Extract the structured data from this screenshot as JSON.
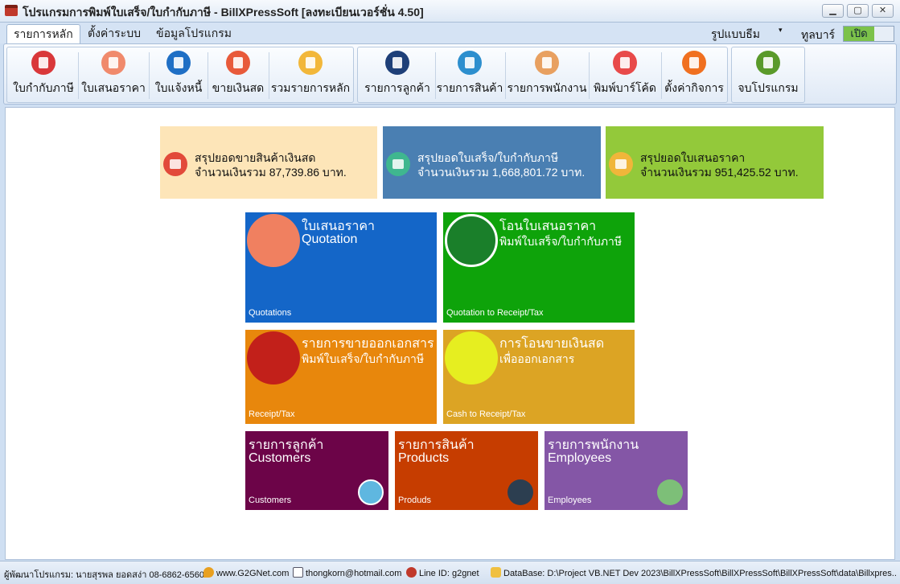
{
  "window": {
    "title": "โปรแกรมการพิมพ์ใบเสร็จ/ใบกำกับภาษี - BillXPressSoft [ลงทะเบียนเวอร์ชั่น 4.50]",
    "icon": "cash-register-icon",
    "minimize": "▁",
    "maximize": "▢",
    "close": "✕"
  },
  "tabs": [
    "รายการหลัก",
    "ตั้งค่าระบบ",
    "ข้อมูลโปรแกรม"
  ],
  "theme": {
    "label": "รูปแบบธีม",
    "caret": "▾"
  },
  "toolbar": {
    "label": "ทูลบาร์",
    "toggle": "เปิด"
  },
  "ribbon": {
    "group1": [
      {
        "label": "ใบกำกับภาษี",
        "icon": "invoice-icon",
        "color": "#d9383a"
      },
      {
        "label": "ใบเสนอราคา",
        "icon": "quotation-icon",
        "color": "#f08a6c"
      },
      {
        "label": "ใบแจ้งหนี้",
        "icon": "bill-icon",
        "color": "#1f6fc5"
      },
      {
        "label": "ขายเงินสด",
        "icon": "cash-sale-icon",
        "color": "#e85a3a"
      },
      {
        "label": "รวมรายการหลัก",
        "icon": "transfer-icon",
        "color": "#f2b73a"
      }
    ],
    "group2": [
      {
        "label": "รายการลูกค้า",
        "icon": "customer-card-icon",
        "color": "#1e3f78"
      },
      {
        "label": "รายการสินค้า",
        "icon": "products-icon",
        "color": "#2d8fce"
      },
      {
        "label": "รายการพนักงาน",
        "icon": "employees-icon",
        "color": "#e8a060"
      },
      {
        "label": "พิมพ์บาร์โค้ด",
        "icon": "barcode-icon",
        "color": "#e84a4a"
      },
      {
        "label": "ตั้งค่ากิจการ",
        "icon": "company-settings-icon",
        "color": "#f07020"
      }
    ],
    "group3": [
      {
        "label": "จบโปรแกรม",
        "icon": "power-icon",
        "color": "#5a9a2a"
      }
    ]
  },
  "summaries": [
    {
      "line1": "สรุปยอดขายสินค้าเงินสด",
      "line2": "จำนวนเงินรวม 87,739.86 บาท.",
      "bg": "#fde5b8",
      "fg": "#111111",
      "icon": "cash-icon",
      "icon_color": "#e24a3a"
    },
    {
      "line1": "สรุปยอดใบเสร็จ/ใบกำกับภาษี",
      "line2": "จำนวนเงินรวม 1,668,801.72 บาท.",
      "bg": "#4a7fb2",
      "fg": "#ffffff",
      "icon": "receipt-icon",
      "icon_color": "#3fb78f"
    },
    {
      "line1": "สรุปยอดใบเสนอราคา",
      "line2": "จำนวนเงินรวม 951,425.52 บาท.",
      "bg": "#93c93a",
      "fg": "#111111",
      "icon": "quote-summary-icon",
      "icon_color": "#f0b63a"
    }
  ],
  "tiles": [
    {
      "title1": "ใบเสนอราคา",
      "title2": "Quotation",
      "footer": "Quotations",
      "bg": "#1466c8",
      "icon": "quotation-document-icon",
      "icon_color": "#f08060"
    },
    {
      "title1": "โอนใบเสนอราคา",
      "title2": "พิมพ์ใบเสร็จ/ใบกำกับภาษี",
      "footer": "Quotation to Receipt/Tax",
      "bg": "#0ea30a",
      "icon": "clipboard-check-icon",
      "icon_color": "#1a7f2a"
    },
    {
      "title1": "รายการขายออกเอกสาร",
      "title2": "พิมพ์ใบเสร็จ/ใบกำกับภาษี",
      "footer": "Receipt/Tax",
      "bg": "#e8870c",
      "icon": "tax-document-icon",
      "icon_color": "#c2201a"
    },
    {
      "title1": "การโอนขายเงินสด",
      "title2": "เพื่อออกเอกสาร",
      "footer": "Cash to Receipt/Tax",
      "bg": "#dca424",
      "icon": "cash-register-icon",
      "icon_color": "#e6ee20"
    },
    {
      "title1": "รายการลูกค้า",
      "title2": "Customers",
      "footer": "Customers",
      "bg": "#6c0448",
      "icon": "customers-group-icon",
      "icon_color": "#5fb7e0"
    },
    {
      "title1": "รายการสินค้า",
      "title2": "Products",
      "footer": "Produds",
      "bg": "#c63d00",
      "icon": "hand-truck-icon",
      "icon_color": "#2c3e50"
    },
    {
      "title1": "รายการพนักงาน",
      "title2": "Employees",
      "footer": "Employees",
      "bg": "#8456a6",
      "icon": "employees-people-icon",
      "icon_color": "#7dbf78"
    }
  ],
  "statusbar": {
    "developer": "ผู้พัฒนาโปรแกรม: นายสุรพล ยอดสง่า 08-6862-6560",
    "website": "www.G2GNet.com",
    "email": "thongkorn@hotmail.com",
    "line": "Line ID: g2gnet",
    "database": "DataBase: D:\\Project VB.NET Dev 2023\\BillXPressSoft\\BillXPressSoft\\BillXPressSoft\\data\\Billxpres..."
  }
}
